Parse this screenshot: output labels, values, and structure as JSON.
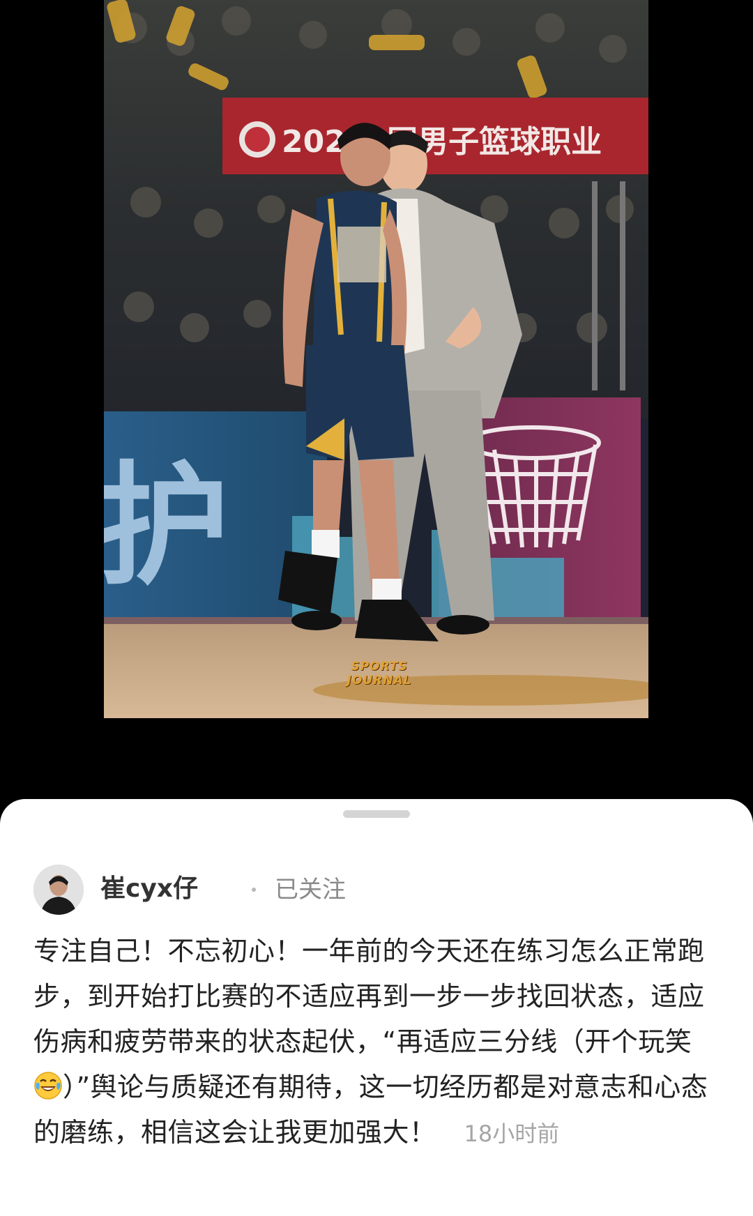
{
  "photo": {
    "alt_icon": "basketball-photo",
    "banner_text": "202 中国男子篮球职业",
    "board_text": "护",
    "watermark_line1": "SPORTS",
    "watermark_line2": "JOURNAL"
  },
  "post": {
    "author_name": "崔cyx仔",
    "follow_status": "已关注",
    "text_before_emoji": "专注自己！不忘初心！一年前的今天还在练习怎么正常跑步，到开始打比赛的不适应再到一步一步找回状态，适应伤病和疲劳带来的状态起伏，“再适应三分线（开个玩笑",
    "emoji": "laughing-tears-emoji",
    "text_after_emoji": "）”舆论与质疑还有期待，这一切经历都是对意志和心态的磨练，相信这会让我更加强大！",
    "time": "18小时前"
  },
  "colors": {
    "sheet_bg": "#ffffff",
    "text": "#222222",
    "muted": "#8a8a8a",
    "handle": "#d4d4d4"
  }
}
